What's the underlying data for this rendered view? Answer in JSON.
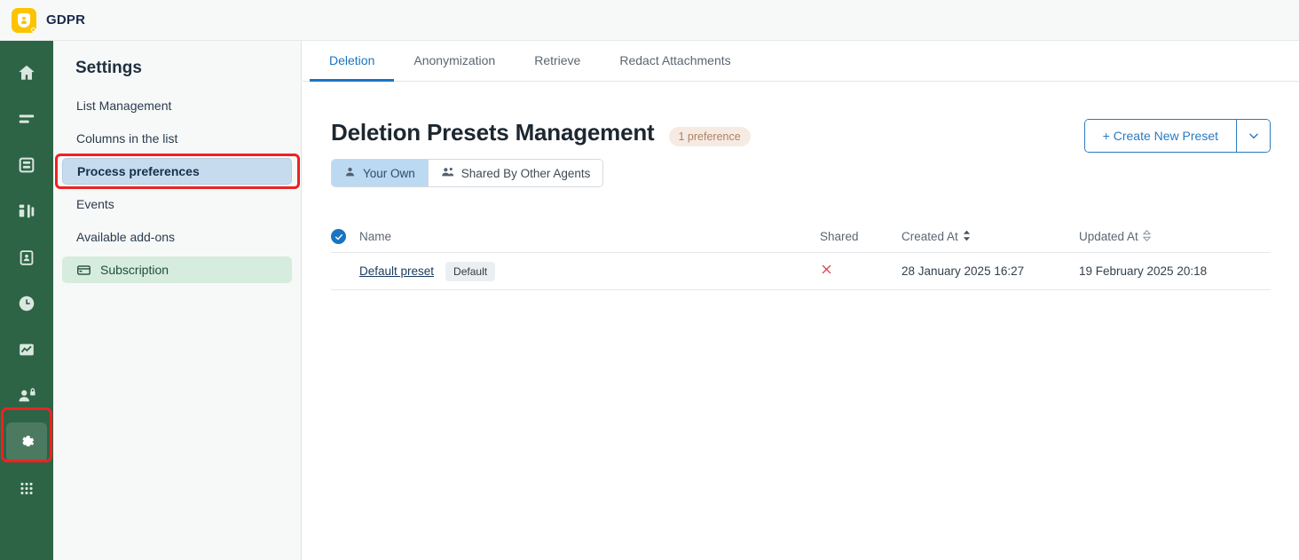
{
  "app": {
    "brand": "GDPR",
    "logo_icon": "shield-person-icon",
    "rail_color": "#2d6446",
    "accent_color": "#1a74c0"
  },
  "rail": {
    "items": [
      {
        "name": "home-icon",
        "label": "Home",
        "active": false
      },
      {
        "name": "list-icon",
        "label": "Lists",
        "active": false
      },
      {
        "name": "database-icon",
        "label": "Database",
        "active": false
      },
      {
        "name": "workflow-icon",
        "label": "Workflow",
        "active": false
      },
      {
        "name": "clipboard-person-icon",
        "label": "Requests",
        "active": false
      },
      {
        "name": "clock-icon",
        "label": "History",
        "active": false
      },
      {
        "name": "chart-icon",
        "label": "Reports",
        "active": false
      },
      {
        "name": "user-lock-icon",
        "label": "Privacy",
        "active": false
      },
      {
        "name": "gear-icon",
        "label": "Settings",
        "active": true
      },
      {
        "name": "grid-apps-icon",
        "label": "Apps",
        "active": false
      }
    ]
  },
  "settings": {
    "title": "Settings",
    "items": [
      {
        "label": "List Management",
        "state": "normal",
        "icon": null
      },
      {
        "label": "Columns in the list",
        "state": "normal",
        "icon": null
      },
      {
        "label": "Process preferences",
        "state": "selected",
        "icon": null
      },
      {
        "label": "Events",
        "state": "normal",
        "icon": null
      },
      {
        "label": "Available add-ons",
        "state": "normal",
        "icon": null
      },
      {
        "label": "Subscription",
        "state": "subscription",
        "icon": "credit-card-icon"
      }
    ]
  },
  "tabs": [
    {
      "label": "Deletion",
      "active": true
    },
    {
      "label": "Anonymization",
      "active": false
    },
    {
      "label": "Retrieve",
      "active": false
    },
    {
      "label": "Redact Attachments",
      "active": false
    }
  ],
  "main": {
    "page_title": "Deletion Presets Management",
    "count_badge": "1 preference",
    "segmented": [
      {
        "label": "Your Own",
        "icon": "person-icon",
        "active": true
      },
      {
        "label": "Shared By Other Agents",
        "icon": "people-icon",
        "active": false
      }
    ],
    "create_button": {
      "label": "+ Create New Preset",
      "caret_icon": "chevron-down-icon"
    }
  },
  "table": {
    "select_all_checked": true,
    "columns": [
      {
        "key": "name",
        "label": "Name",
        "sort": null
      },
      {
        "key": "shared",
        "label": "Shared",
        "sort": null
      },
      {
        "key": "created",
        "label": "Created At",
        "sort": "active"
      },
      {
        "key": "updated",
        "label": "Updated At",
        "sort": "inactive"
      }
    ],
    "rows": [
      {
        "name": "Default preset",
        "badge": "Default",
        "shared_icon": "x-icon",
        "created_at": "28 January 2025 16:27",
        "updated_at": "19 February 2025 20:18"
      }
    ]
  },
  "annotations": [
    {
      "name": "process-preferences-highlight",
      "color": "#ee2222"
    },
    {
      "name": "settings-gear-highlight",
      "color": "#ee2222"
    }
  ]
}
